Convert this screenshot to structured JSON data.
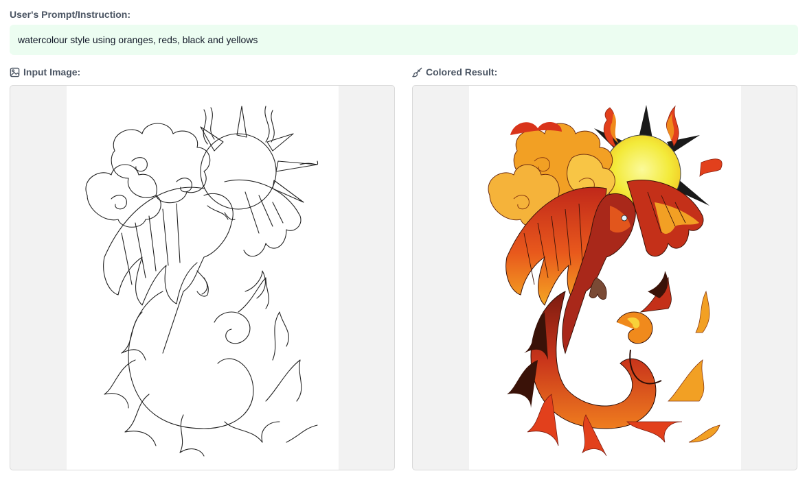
{
  "prompt": {
    "label": "User's Prompt/Instruction:",
    "text": "watercolour style using oranges, reds, black and yellows"
  },
  "input_panel": {
    "label": "Input Image:",
    "icon": "image-icon"
  },
  "result_panel": {
    "label": "Colored Result:",
    "icon": "brush-icon"
  },
  "colors": {
    "prompt_bg": "#ecfdf1",
    "panel_bg": "#f2f2f2",
    "sun_yellow": "#f3ea3a",
    "flame_orange": "#f08a1c",
    "flame_red": "#d9341b",
    "dark_red": "#7a1b10",
    "black": "#1a1a1a"
  }
}
